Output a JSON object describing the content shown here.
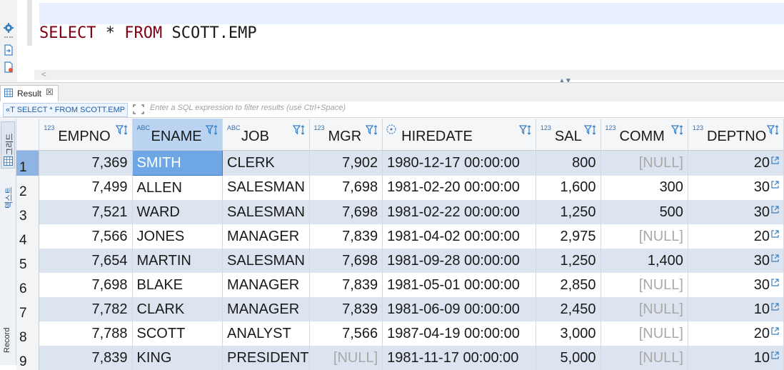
{
  "editor": {
    "sql_keyword1": "SELECT",
    "sql_star": " * ",
    "sql_keyword2": "FROM",
    "sql_table": " SCOTT.EMP",
    "scroll_left": "<"
  },
  "result_tab": {
    "label": "Result",
    "close": "☒"
  },
  "filter": {
    "query_label": "SELECT * FROM SCOTT.EMP",
    "query_prefix": "«T",
    "placeholder": "Enter a SQL expression to filter results (use Ctrl+Space)"
  },
  "side_panel": {
    "grid_label": "그리드",
    "text_label": "텍스트",
    "record_label": "Record"
  },
  "columns": [
    {
      "name": "EMPNO",
      "type": "123"
    },
    {
      "name": "ENAME",
      "type": "ABC"
    },
    {
      "name": "JOB",
      "type": "ABC"
    },
    {
      "name": "MGR",
      "type": "123"
    },
    {
      "name": "HIREDATE",
      "type": "date"
    },
    {
      "name": "SAL",
      "type": "123"
    },
    {
      "name": "COMM",
      "type": "123"
    },
    {
      "name": "DEPTNO",
      "type": "123"
    }
  ],
  "rows": [
    {
      "n": "1",
      "empno": "7,369",
      "ename": "SMITH",
      "job": "CLERK",
      "mgr": "7,902",
      "hiredate": "1980-12-17 00:00:00",
      "sal": "800",
      "comm": "[NULL]",
      "deptno": "20"
    },
    {
      "n": "2",
      "empno": "7,499",
      "ename": "ALLEN",
      "job": "SALESMAN",
      "mgr": "7,698",
      "hiredate": "1981-02-20 00:00:00",
      "sal": "1,600",
      "comm": "300",
      "deptno": "30"
    },
    {
      "n": "3",
      "empno": "7,521",
      "ename": "WARD",
      "job": "SALESMAN",
      "mgr": "7,698",
      "hiredate": "1981-02-22 00:00:00",
      "sal": "1,250",
      "comm": "500",
      "deptno": "30"
    },
    {
      "n": "4",
      "empno": "7,566",
      "ename": "JONES",
      "job": "MANAGER",
      "mgr": "7,839",
      "hiredate": "1981-04-02 00:00:00",
      "sal": "2,975",
      "comm": "[NULL]",
      "deptno": "20"
    },
    {
      "n": "5",
      "empno": "7,654",
      "ename": "MARTIN",
      "job": "SALESMAN",
      "mgr": "7,698",
      "hiredate": "1981-09-28 00:00:00",
      "sal": "1,250",
      "comm": "1,400",
      "deptno": "30"
    },
    {
      "n": "6",
      "empno": "7,698",
      "ename": "BLAKE",
      "job": "MANAGER",
      "mgr": "7,839",
      "hiredate": "1981-05-01 00:00:00",
      "sal": "2,850",
      "comm": "[NULL]",
      "deptno": "30"
    },
    {
      "n": "7",
      "empno": "7,782",
      "ename": "CLARK",
      "job": "MANAGER",
      "mgr": "7,839",
      "hiredate": "1981-06-09 00:00:00",
      "sal": "2,450",
      "comm": "[NULL]",
      "deptno": "10"
    },
    {
      "n": "8",
      "empno": "7,788",
      "ename": "SCOTT",
      "job": "ANALYST",
      "mgr": "7,566",
      "hiredate": "1987-04-19 00:00:00",
      "sal": "3,000",
      "comm": "[NULL]",
      "deptno": "20"
    },
    {
      "n": "9",
      "empno": "7,839",
      "ename": "KING",
      "job": "PRESIDENT",
      "mgr": "[NULL]",
      "hiredate": "1981-11-17 00:00:00",
      "sal": "5,000",
      "comm": "[NULL]",
      "deptno": "10"
    }
  ],
  "colors": {
    "selection": "#6fa6e4",
    "odd_row": "#dbe4ef",
    "keyword": "#7f0015",
    "accent": "#1f5fa6"
  }
}
